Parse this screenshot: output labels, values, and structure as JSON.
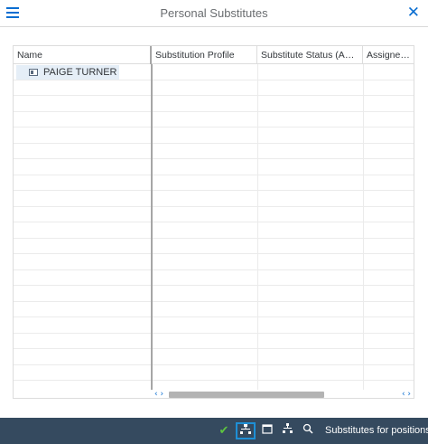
{
  "window": {
    "title": "Personal Substitutes",
    "menu_icon": "hamburger-menu-icon",
    "close_icon": "close-icon"
  },
  "table": {
    "columns": [
      {
        "label": "Name"
      },
      {
        "label": "Substitution Profile"
      },
      {
        "label": "Substitute Status (Acti..."
      },
      {
        "label": "Assigned..."
      }
    ],
    "rows": [
      {
        "name": "PAIGE TURNER",
        "icon": "person-card-icon",
        "profile": "",
        "status": "",
        "assigned": ""
      }
    ]
  },
  "footer": {
    "buttons": [
      {
        "icon": "checkmark-icon"
      },
      {
        "icon": "hierarchy-icon"
      },
      {
        "icon": "calendar-icon"
      },
      {
        "icon": "org-tree-icon"
      },
      {
        "icon": "zoom-icon"
      }
    ],
    "substitutes_label": "Substitutes for positions"
  },
  "colors": {
    "accent": "#0a6ed1",
    "footer_bg": "#354a5f",
    "selection": "#e5eef7",
    "check": "#5ec53f"
  }
}
